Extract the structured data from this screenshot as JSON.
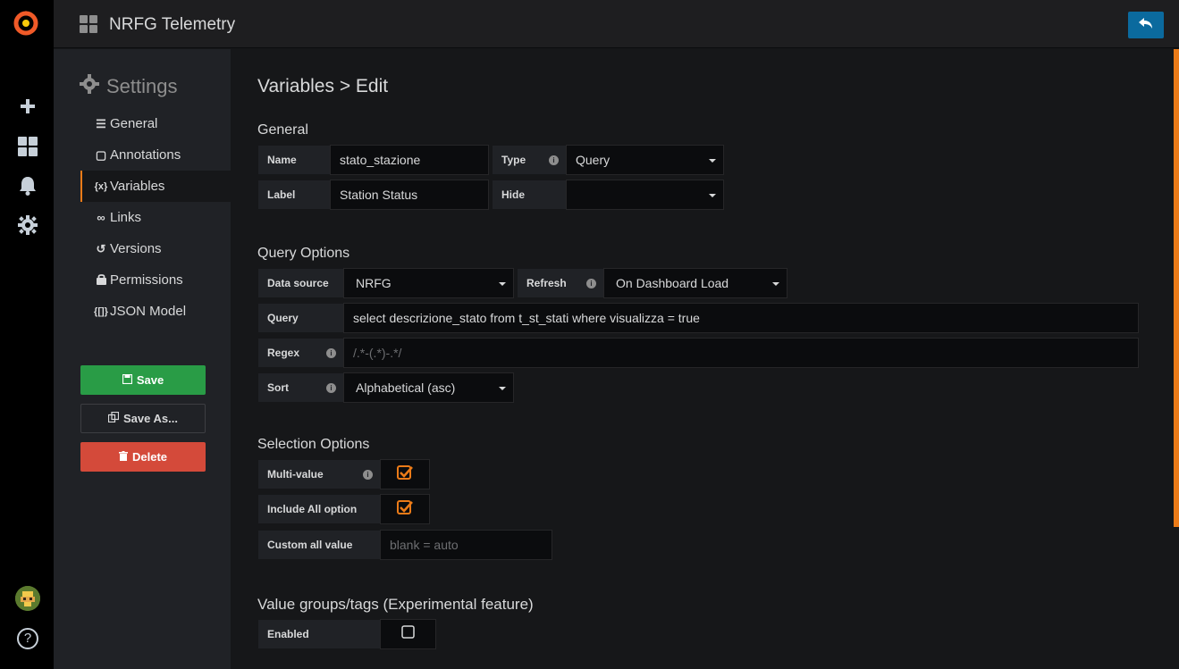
{
  "app": {
    "dashboard_title": "NRFG Telemetry"
  },
  "sidemenu": {
    "icons": [
      "grafana-logo-icon",
      "plus-icon",
      "dashboards-icon",
      "bell-icon",
      "gear-icon",
      "avatar",
      "help-icon"
    ],
    "help_label": "?"
  },
  "settings_nav": {
    "heading": "Settings",
    "items": [
      {
        "label": "General",
        "icon": "sliders-icon"
      },
      {
        "label": "Annotations",
        "icon": "comment-icon"
      },
      {
        "label": "Variables",
        "icon": "variable-icon",
        "active": true
      },
      {
        "label": "Links",
        "icon": "link-icon"
      },
      {
        "label": "Versions",
        "icon": "history-icon"
      },
      {
        "label": "Permissions",
        "icon": "lock-icon"
      },
      {
        "label": "JSON Model",
        "icon": "json-icon"
      }
    ],
    "save_label": "Save",
    "save_as_label": "Save As...",
    "delete_label": "Delete"
  },
  "page": {
    "title": "Variables > Edit"
  },
  "general": {
    "section_title": "General",
    "name_label": "Name",
    "name_value": "stato_stazione",
    "type_label": "Type",
    "type_value": "Query",
    "label_label": "Label",
    "label_value": "Station Status",
    "hide_label": "Hide",
    "hide_value": ""
  },
  "query_options": {
    "section_title": "Query Options",
    "datasource_label": "Data source",
    "datasource_value": "NRFG",
    "refresh_label": "Refresh",
    "refresh_value": "On Dashboard Load",
    "query_label": "Query",
    "query_value": "select descrizione_stato from t_st_stati where visualizza = true",
    "regex_label": "Regex",
    "regex_placeholder": "/.*-(.*)-.*/",
    "sort_label": "Sort",
    "sort_value": "Alphabetical (asc)"
  },
  "selection_options": {
    "section_title": "Selection Options",
    "multi_label": "Multi-value",
    "multi_checked": true,
    "include_all_label": "Include All option",
    "include_all_checked": true,
    "custom_all_label": "Custom all value",
    "custom_all_placeholder": "blank = auto"
  },
  "value_groups": {
    "section_title": "Value groups/tags (Experimental feature)",
    "enabled_label": "Enabled",
    "enabled_checked": false
  },
  "colors": {
    "accent": "#eb7b18",
    "save": "#299c46",
    "delete": "#d44a3a",
    "back": "#0b6a9e"
  }
}
